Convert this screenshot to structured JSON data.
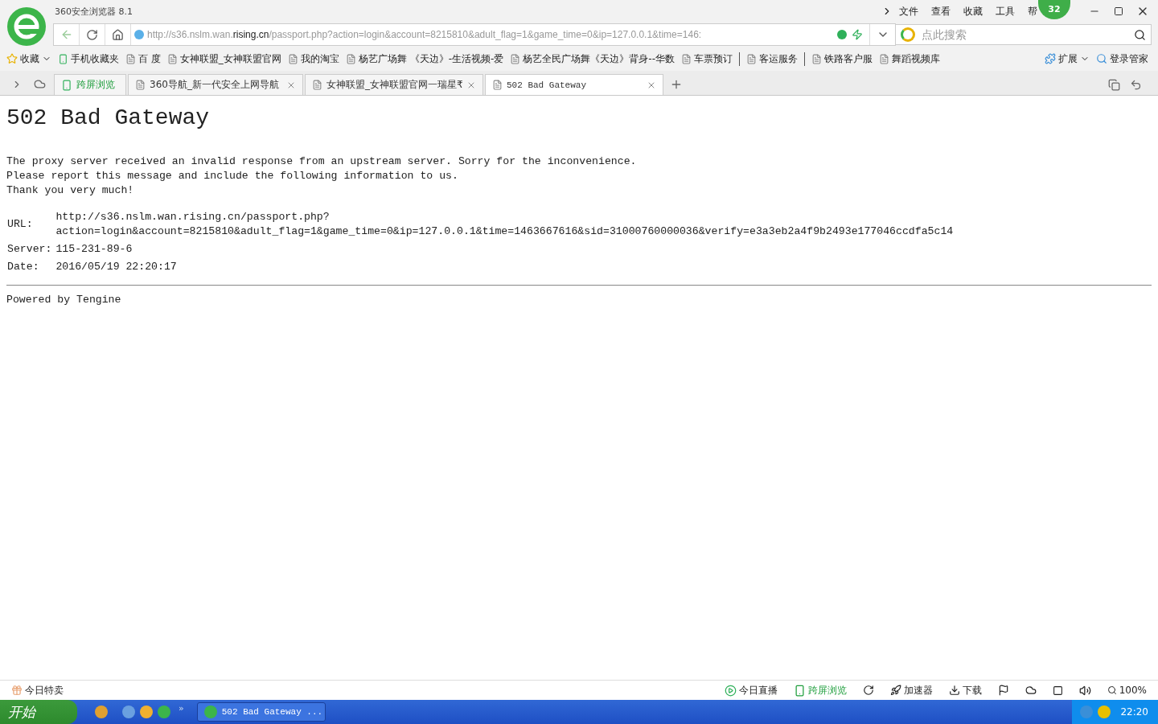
{
  "window": {
    "title": "360安全浏览器 8.1",
    "menu": [
      "文件",
      "查看",
      "收藏",
      "工具",
      "帮"
    ],
    "badge": "32"
  },
  "address": {
    "url_prefix": "http://s36.nslm.wan.",
    "url_domain": "rising.cn",
    "url_rest": "/passport.php?action=login&account=8215810&adult_flag=1&game_time=0&ip=127.0.0.1&time=146:",
    "search_placeholder": "点此搜索"
  },
  "bookmarks": {
    "favorites": "收藏",
    "items": [
      {
        "label": "手机收藏夹",
        "divider": false
      },
      {
        "label": "百 度",
        "divider": false
      },
      {
        "label": "女神联盟_女神联盟官网",
        "divider": false
      },
      {
        "label": "我的淘宝",
        "divider": false
      },
      {
        "label": "杨艺广场舞  《天边》-生活视频-爱",
        "divider": false
      },
      {
        "label": "杨艺全民广场舞《天边》背身--华数",
        "divider": false
      },
      {
        "label": "车票预订",
        "divider": true
      },
      {
        "label": "客运服务",
        "divider": true
      },
      {
        "label": "铁路客户服",
        "divider": false
      },
      {
        "label": "舞蹈视频库",
        "divider": false
      }
    ],
    "extensions": "扩展",
    "login": "登录管家"
  },
  "tabs": [
    {
      "label": "跨屏浏览",
      "kind": "special",
      "selected": false
    },
    {
      "label": "360导航_新一代安全上网导航",
      "kind": "page",
      "selected": false
    },
    {
      "label": "女神联盟_女神联盟官网一瑞星₹",
      "kind": "page",
      "selected": false
    },
    {
      "label": "502 Bad Gateway",
      "kind": "page",
      "selected": true
    }
  ],
  "page": {
    "heading": "502 Bad Gateway",
    "paragraphs": [
      "The proxy server received an invalid response from an upstream server. Sorry for the inconvenience.",
      "Please report this message and include the following information to us.",
      "Thank you very much!"
    ],
    "info": [
      {
        "label": "URL:",
        "lines": [
          "http://s36.nslm.wan.rising.cn/passport.php?",
          "action=login&account=8215810&adult_flag=1&game_time=0&ip=127.0.0.1&time=1463667616&sid=31000760000036&verify=e3a3eb2a4f9b2493e177046ccdfa5c14"
        ]
      },
      {
        "label": "Server:",
        "lines": [
          "115-231-89-6"
        ]
      },
      {
        "label": "Date:",
        "lines": [
          "2016/05/19 22:20:17"
        ]
      }
    ],
    "footer": "Powered by Tengine"
  },
  "status_bar": {
    "left": "今日特卖",
    "live": "今日直播",
    "cross": "跨屏浏览",
    "accelerator": "加速器",
    "download": "下载",
    "zoom": "100%"
  },
  "taskbar": {
    "start": "开始",
    "more": "»",
    "task": "502 Bad Gateway ...",
    "clock": "22:20"
  }
}
